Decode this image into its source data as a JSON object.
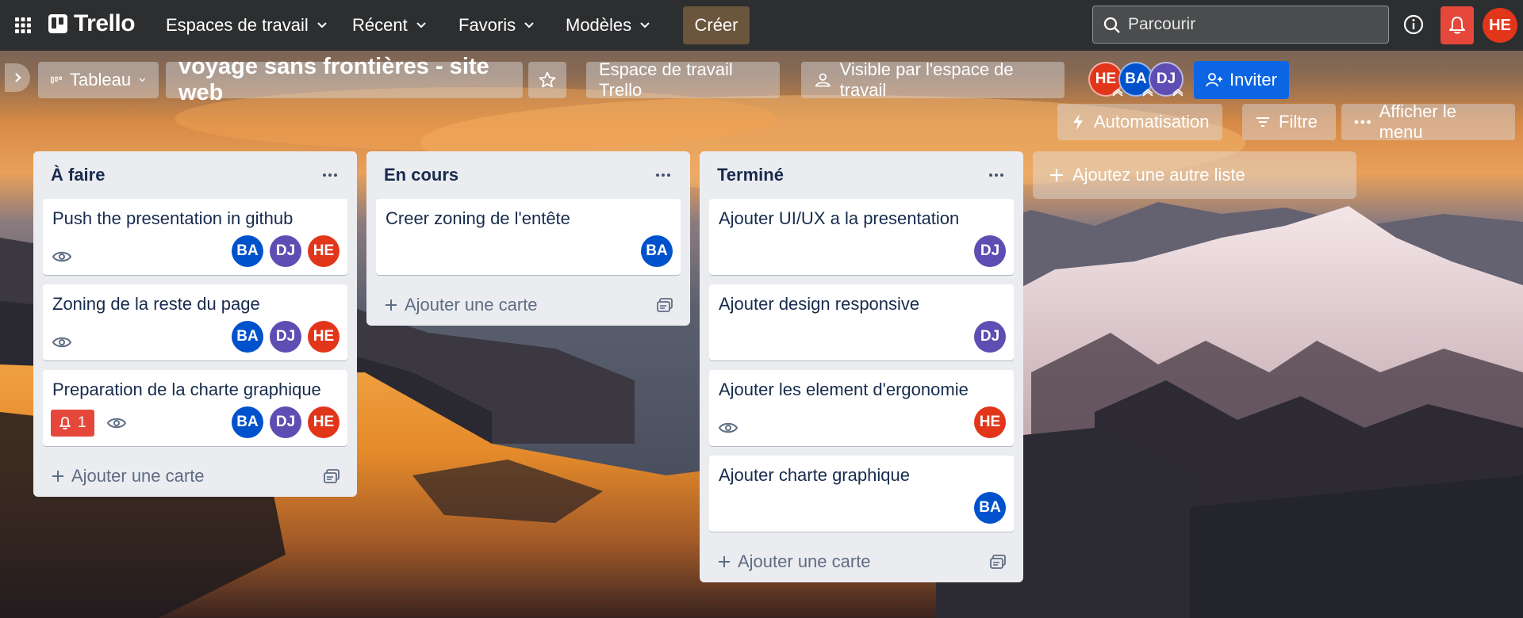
{
  "colors": {
    "header_bg": "#2c2e30",
    "create_btn": "#6b553c",
    "invite_btn": "#0c66e4",
    "notif_btn": "#e5483b",
    "avatar_ba": "#0052cc",
    "avatar_dj": "#5e4db2",
    "avatar_he": "#e2361b",
    "list_bg": "#ebecf0"
  },
  "header": {
    "app_name": "Trello",
    "nav": [
      {
        "label": "Espaces de travail"
      },
      {
        "label": "Récent"
      },
      {
        "label": "Favoris"
      },
      {
        "label": "Modèles"
      }
    ],
    "create_label": "Créer",
    "search_placeholder": "Parcourir",
    "user_initials": "HE"
  },
  "board": {
    "view_label": "Tableau",
    "title": "voyage sans frontières - site web",
    "workspace_label": "Espace de travail Trello",
    "visibility_label": "Visible par l'espace de travail",
    "members": [
      "HE",
      "BA",
      "DJ"
    ],
    "invite_label": "Inviter",
    "automation_label": "Automatisation",
    "filter_label": "Filtre",
    "menu_label": "Afficher le menu"
  },
  "lists": [
    {
      "title": "À faire",
      "cards": [
        {
          "title": "Push the presentation in github",
          "members": [
            "BA",
            "DJ",
            "HE"
          ]
        },
        {
          "title": "Zoning de la reste du page",
          "members": [
            "BA",
            "DJ",
            "HE"
          ]
        },
        {
          "title": "Preparation de la charte graphique",
          "notif_count": "1",
          "members": [
            "BA",
            "DJ",
            "HE"
          ]
        }
      ],
      "add_card_label": "Ajouter une carte"
    },
    {
      "title": "En cours",
      "cards": [
        {
          "title": "Creer zoning de l'entête",
          "members": [
            "BA"
          ]
        }
      ],
      "add_card_label": "Ajouter une carte"
    },
    {
      "title": "Terminé",
      "cards": [
        {
          "title": "Ajouter UI/UX a la presentation",
          "members": [
            "DJ"
          ]
        },
        {
          "title": "Ajouter design responsive",
          "members": [
            "DJ"
          ]
        },
        {
          "title": "Ajouter les element d'ergonomie",
          "members": [
            "HE"
          ]
        },
        {
          "title": "Ajouter charte graphique",
          "members": [
            "BA"
          ]
        }
      ],
      "add_card_label": "Ajouter une carte"
    }
  ],
  "add_list_label": "Ajoutez une autre liste"
}
